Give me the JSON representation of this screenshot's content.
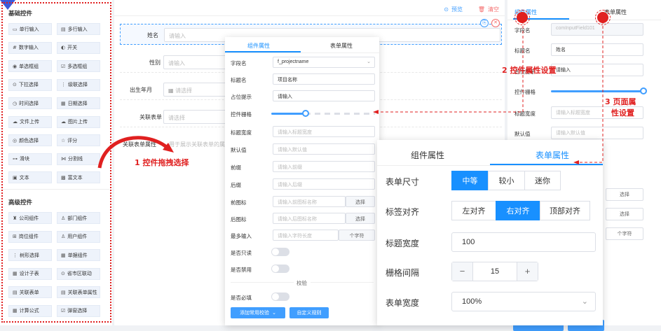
{
  "palette": {
    "basic_title": "基础控件",
    "basic_items": [
      {
        "label": "单行输入",
        "icon": "▭"
      },
      {
        "label": "多行输入",
        "icon": "▤"
      },
      {
        "label": "数字输入",
        "icon": "#"
      },
      {
        "label": "开关",
        "icon": "◐"
      },
      {
        "label": "单选框组",
        "icon": "◉"
      },
      {
        "label": "多选框组",
        "icon": "☑"
      },
      {
        "label": "下拉选择",
        "icon": "⊙"
      },
      {
        "label": "级联选择",
        "icon": "⋮"
      },
      {
        "label": "时间选择",
        "icon": "◷"
      },
      {
        "label": "日期选择",
        "icon": "▦"
      },
      {
        "label": "文件上传",
        "icon": "☁"
      },
      {
        "label": "图片上传",
        "icon": "☁"
      },
      {
        "label": "颜色选择",
        "icon": "◎"
      },
      {
        "label": "评分",
        "icon": "☆"
      },
      {
        "label": "滑块",
        "icon": "⊶"
      },
      {
        "label": "分割线",
        "icon": "⋈"
      },
      {
        "label": "文本",
        "icon": "▣"
      },
      {
        "label": "富文本",
        "icon": "▩"
      }
    ],
    "advanced_title": "高级控件",
    "advanced_items": [
      {
        "label": "公司组件",
        "icon": "♜"
      },
      {
        "label": "部门组件",
        "icon": "♙"
      },
      {
        "label": "岗位组件",
        "icon": "⊞"
      },
      {
        "label": "用户组件",
        "icon": "♙"
      },
      {
        "label": "树形选择",
        "icon": "⋮"
      },
      {
        "label": "单据组件",
        "icon": "▦"
      },
      {
        "label": "设计子表",
        "icon": "▦"
      },
      {
        "label": "省市区联动",
        "icon": "⊙"
      },
      {
        "label": "关联表单",
        "icon": "▤"
      },
      {
        "label": "关联表单属性",
        "icon": "▤"
      },
      {
        "label": "计算公式",
        "icon": "▦"
      },
      {
        "label": "弹窗选择",
        "icon": "☑"
      }
    ]
  },
  "toolbar": {
    "preview": "预览",
    "clear": "清空"
  },
  "canvas": {
    "rows": [
      {
        "label": "姓名",
        "placeholder": "请输入"
      },
      {
        "label": "性别",
        "placeholder": "请输入"
      },
      {
        "label": "出生年月",
        "placeholder": "请选择"
      },
      {
        "label": "关联表单",
        "placeholder": "请选择"
      },
      {
        "label": "关联表单属性",
        "placeholder": "用于展示关联表单的属"
      }
    ]
  },
  "control_panel": {
    "tab_control": "组件属性",
    "tab_form": "表单属性",
    "field_name_label": "字段名",
    "field_name_value": "f_projectname",
    "title_label": "标题名",
    "title_value": "项目名称",
    "placeholder_label": "占位提示",
    "placeholder_value": "请输入",
    "grid_label": "控件栅格",
    "title_width_label": "标题宽度",
    "title_width_ph": "请输入标题宽度",
    "default_label": "默认值",
    "default_ph": "请输入默认值",
    "prefix_label": "前缀",
    "prefix_ph": "请输入前缀",
    "suffix_label": "后缀",
    "suffix_ph": "请输入后缀",
    "prefix_icon_label": "前图标",
    "prefix_icon_ph": "请输入前图标名称",
    "suffix_icon_label": "后图标",
    "suffix_icon_ph": "请输入后图标名称",
    "select_btn": "选择",
    "maxlen_label": "最多输入",
    "maxlen_ph": "请输入字符长度",
    "maxlen_unit": "个字符",
    "readonly_label": "是否只读",
    "disabled_label": "是否禁用",
    "validate_divider": "校验",
    "required_label": "是否必填",
    "add_rule_btn": "添加常用校验",
    "custom_rule_btn": "自定义规则"
  },
  "right_panel": {
    "tab_control": "组件属性",
    "tab_form": "表单属性",
    "field_name_label": "字段名",
    "field_name_value": "comInputField101",
    "title_label": "标题名",
    "title_value": "姓名",
    "placeholder_label": "占位提示",
    "placeholder_value": "请输入",
    "grid_label": "控件栅格",
    "title_width_label": "标题宽度",
    "title_width_ph": "请输入标题宽度",
    "default_label": "默认值",
    "default_ph": "请输入默认值",
    "select_btn": "选择",
    "maxlen_unit": "个字符"
  },
  "form_panel": {
    "tab_control": "组件属性",
    "tab_form": "表单属性",
    "size_label": "表单尺寸",
    "size_options": [
      "中等",
      "较小",
      "迷你"
    ],
    "size_selected": 0,
    "align_label": "标签对齐",
    "align_options": [
      "左对齐",
      "右对齐",
      "顶部对齐"
    ],
    "align_selected": 1,
    "title_width_label": "标题宽度",
    "title_width_value": "100",
    "gutter_label": "栅格间隔",
    "gutter_value": "15",
    "minus": "−",
    "plus": "+",
    "form_width_label": "表单宽度",
    "form_width_value": "100%"
  },
  "annotations": {
    "a1": "1 控件拖拽选择",
    "a2": "2 控件属性设置",
    "a3_line1": "3 页面属",
    "a3_line2": "性设置"
  },
  "colors": {
    "accent": "#1890ff",
    "annotation": "#e02020",
    "palette_item_bg": "#eef3fb"
  }
}
